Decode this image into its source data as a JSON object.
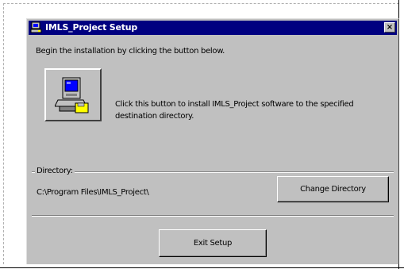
{
  "window": {
    "title": "IMLS_Project Setup",
    "close_glyph": "×"
  },
  "instruction": "Begin the installation by clicking the button below.",
  "install": {
    "icon": "computer-install-icon",
    "description": "Click this button to install IMLS_Project software to the specified destination directory."
  },
  "directory": {
    "legend": "Directory:",
    "path": "C:\\Program Files\\IMLS_Project\\",
    "change_label": "Change Directory"
  },
  "exit_label": "Exit Setup",
  "colors": {
    "title_bar": "#000080",
    "dialog_face": "#c0c0c0"
  }
}
